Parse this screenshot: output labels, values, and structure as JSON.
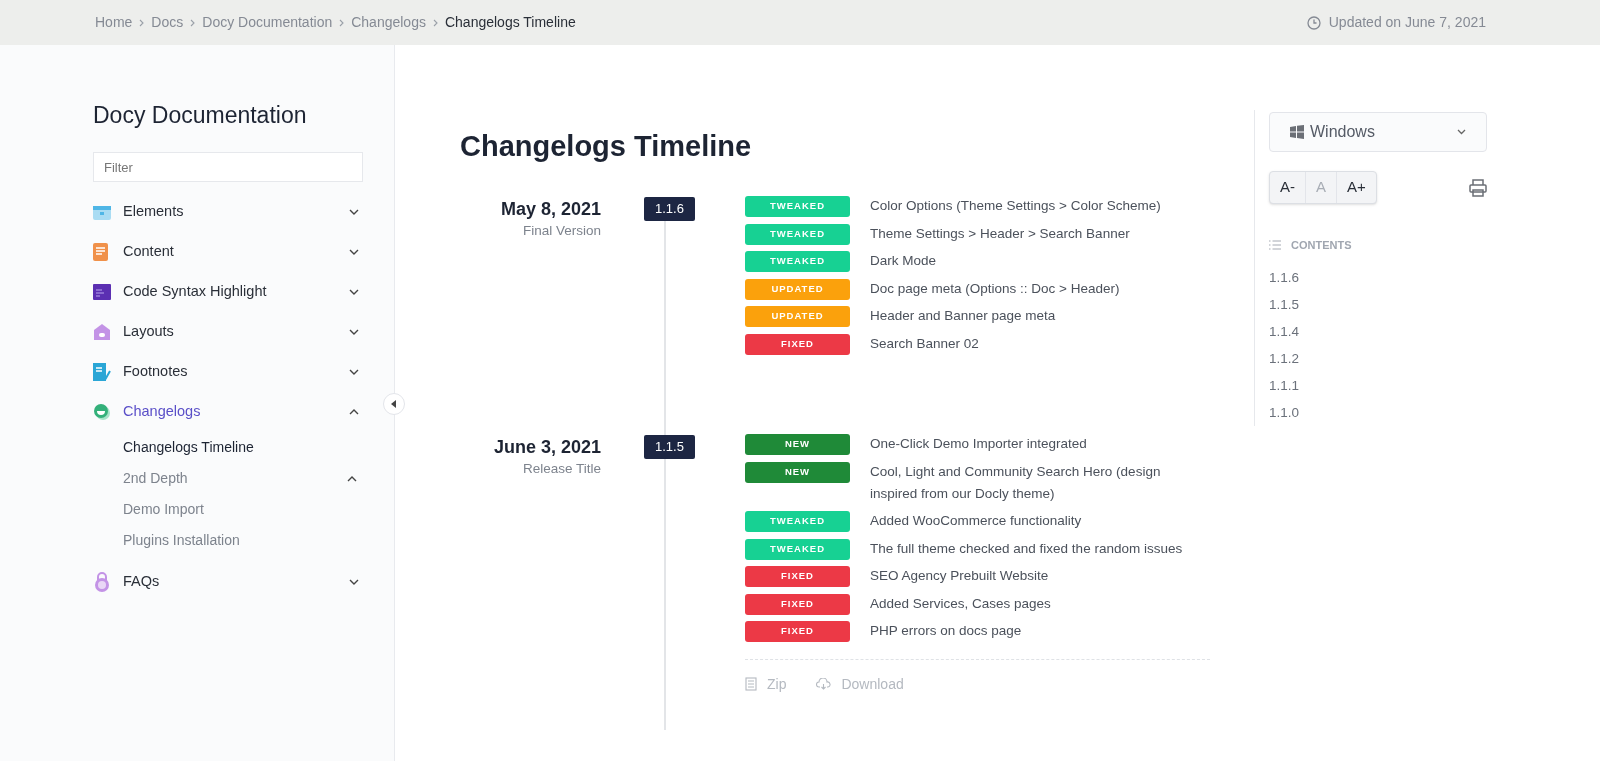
{
  "breadcrumb": [
    {
      "label": "Home"
    },
    {
      "label": "Docs"
    },
    {
      "label": "Docy Documentation"
    },
    {
      "label": "Changelogs"
    },
    {
      "label": "Changelogs Timeline",
      "current": true
    }
  ],
  "updated": "Updated on June 7, 2021",
  "sidebar": {
    "title": "Docy Documentation",
    "filter_placeholder": "Filter",
    "items": [
      {
        "label": "Elements",
        "expanded": false,
        "selected": false
      },
      {
        "label": "Content",
        "expanded": false,
        "selected": false
      },
      {
        "label": "Code Syntax Highlight",
        "expanded": false,
        "selected": false
      },
      {
        "label": "Layouts",
        "expanded": false,
        "selected": false
      },
      {
        "label": "Footnotes",
        "expanded": false,
        "selected": false
      },
      {
        "label": "Changelogs",
        "expanded": true,
        "selected": true,
        "children": [
          {
            "label": "Changelogs Timeline",
            "selected": true
          },
          {
            "label": "2nd Depth",
            "selected": false,
            "expanded": true
          },
          {
            "label": "Demo Import",
            "selected": false
          },
          {
            "label": "Plugins Installation",
            "selected": false
          }
        ]
      },
      {
        "label": "FAQs",
        "expanded": false,
        "selected": false
      }
    ]
  },
  "page_title": "Changelogs Timeline",
  "releases": [
    {
      "date": "May 8, 2021",
      "subtitle": "Final Version",
      "version": "1.1.6",
      "changes": [
        {
          "kind": "tweaked",
          "tag": "TWEAKED",
          "text": "Color Options (Theme Settings > Color Scheme)"
        },
        {
          "kind": "tweaked",
          "tag": "TWEAKED",
          "text": "Theme Settings > Header > Search Banner"
        },
        {
          "kind": "tweaked",
          "tag": "TWEAKED",
          "text": "Dark Mode"
        },
        {
          "kind": "updated",
          "tag": "UPDATED",
          "text": "Doc page meta (Options :: Doc > Header)"
        },
        {
          "kind": "updated",
          "tag": "UPDATED",
          "text": "Header and Banner page meta"
        },
        {
          "kind": "fixed",
          "tag": "FIXED",
          "text": "Search Banner 02"
        }
      ]
    },
    {
      "date": "June 3, 2021",
      "subtitle": "Release Title",
      "version": "1.1.5",
      "changes": [
        {
          "kind": "new",
          "tag": "NEW",
          "text": "One-Click Demo Importer integrated"
        },
        {
          "kind": "new",
          "tag": "NEW",
          "text": "Cool, Light and Community Search Hero (design inspired from our Docly theme)"
        },
        {
          "kind": "tweaked",
          "tag": "TWEAKED",
          "text": "Added WooCommerce functionality"
        },
        {
          "kind": "tweaked",
          "tag": "TWEAKED",
          "text": "The full theme checked and fixed the random issues"
        },
        {
          "kind": "fixed",
          "tag": "FIXED",
          "text": "SEO Agency Prebuilt Website"
        },
        {
          "kind": "fixed",
          "tag": "FIXED",
          "text": "Added Services, Cases pages"
        },
        {
          "kind": "fixed",
          "tag": "FIXED",
          "text": "PHP errors on docs page"
        }
      ],
      "links": [
        "Zip",
        "Download"
      ]
    }
  ],
  "os_select": "Windows",
  "font_sizes": [
    {
      "label": "A-",
      "selected": false
    },
    {
      "label": "A",
      "selected": true
    },
    {
      "label": "A+",
      "selected": false
    }
  ],
  "contents": {
    "heading": "CONTENTS",
    "items": [
      "1.1.6",
      "1.1.5",
      "1.1.4",
      "1.1.2",
      "1.1.1",
      "1.1.0"
    ]
  }
}
